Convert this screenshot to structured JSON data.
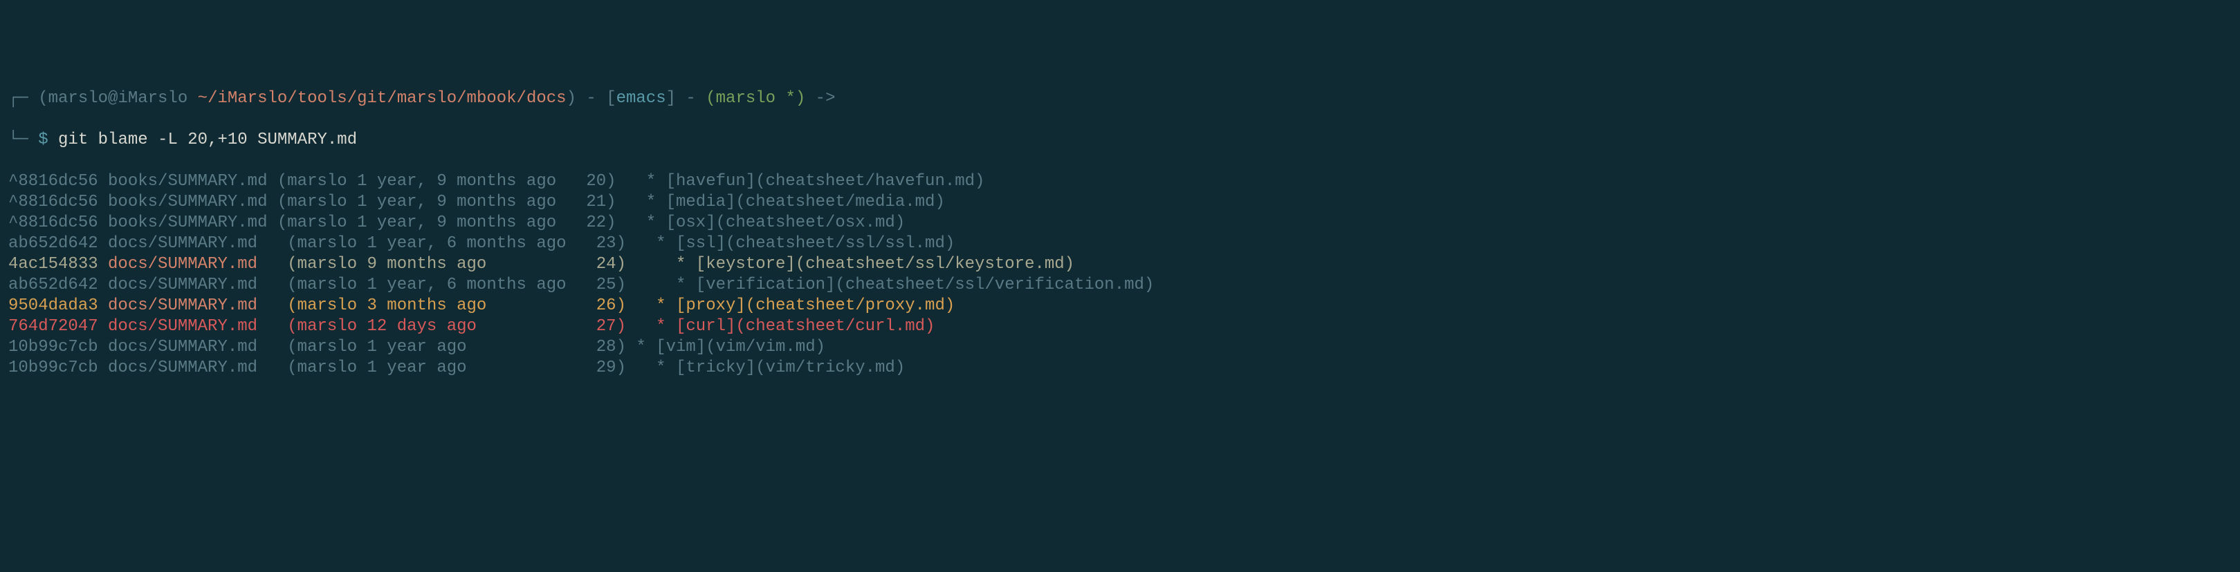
{
  "prompt": {
    "corner_top": "┌─",
    "open_paren": "(",
    "user_host": "marslo@iMarslo ",
    "path": "~/iMarslo/tools/git/marslo/mbook/docs",
    "close_paren": ")",
    "dash1": " - ",
    "lbracket": "[",
    "emacs": "emacs",
    "rbracket": "]",
    "dash2": " - ",
    "branch_open": "(",
    "branch": "marslo *",
    "branch_close": ")",
    "arrow": " ->",
    "corner_bot": "└─",
    "dollar": " $ ",
    "command": "git blame -L 20,+10 SUMMARY.md"
  },
  "blame": [
    {
      "hash": "^8816dc56",
      "file": "books/SUMMARY.md",
      "meta": "(marslo 1 year, 9 months ago",
      "ln": "20)",
      "content": "  * [havefun](cheatsheet/havefun.md)",
      "cls": "dim",
      "pad": ""
    },
    {
      "hash": "^8816dc56",
      "file": "books/SUMMARY.md",
      "meta": "(marslo 1 year, 9 months ago",
      "ln": "21)",
      "content": "  * [media](cheatsheet/media.md)",
      "cls": "dim",
      "pad": ""
    },
    {
      "hash": "^8816dc56",
      "file": "books/SUMMARY.md",
      "meta": "(marslo 1 year, 9 months ago",
      "ln": "22)",
      "content": "  * [osx](cheatsheet/osx.md)",
      "cls": "dim",
      "pad": ""
    },
    {
      "hash": "ab652d642",
      "file": "docs/SUMMARY.md",
      "meta": "(marslo 1 year, 6 months ago",
      "ln": "23)",
      "content": "  * [ssl](cheatsheet/ssl/ssl.md)",
      "cls": "dim",
      "pad": " "
    },
    {
      "hash": "4ac154833",
      "file": "docs/SUMMARY.md",
      "meta": "(marslo 9 months ago",
      "ln": "24)",
      "content": "    * [keystore](cheatsheet/ssl/keystore.md)",
      "cls": "med",
      "pad": " "
    },
    {
      "hash": "ab652d642",
      "file": "docs/SUMMARY.md",
      "meta": "(marslo 1 year, 6 months ago",
      "ln": "25)",
      "content": "    * [verification](cheatsheet/ssl/verification.md)",
      "cls": "dim",
      "pad": " "
    },
    {
      "hash": "9504dada3",
      "file": "docs/SUMMARY.md",
      "meta": "(marslo 3 months ago",
      "ln": "26)",
      "content": "  * [proxy](cheatsheet/proxy.md)",
      "cls": "bright",
      "pad": " "
    },
    {
      "hash": "764d72047",
      "file": "docs/SUMMARY.md",
      "meta": "(marslo 12 days ago",
      "ln": "27)",
      "content": "  * [curl](cheatsheet/curl.md)",
      "cls": "hot",
      "pad": " "
    },
    {
      "hash": "10b99c7cb",
      "file": "docs/SUMMARY.md",
      "meta": "(marslo 1 year ago",
      "ln": "28)",
      "content": "* [vim](vim/vim.md)",
      "cls": "dim",
      "pad": " "
    },
    {
      "hash": "10b99c7cb",
      "file": "docs/SUMMARY.md",
      "meta": "(marslo 1 year ago",
      "ln": "29)",
      "content": "  * [tricky](vim/tricky.md)",
      "cls": "dim",
      "pad": " "
    }
  ],
  "col_widths": {
    "hash": 9,
    "file": 17,
    "meta": 28,
    "ln": 4
  }
}
